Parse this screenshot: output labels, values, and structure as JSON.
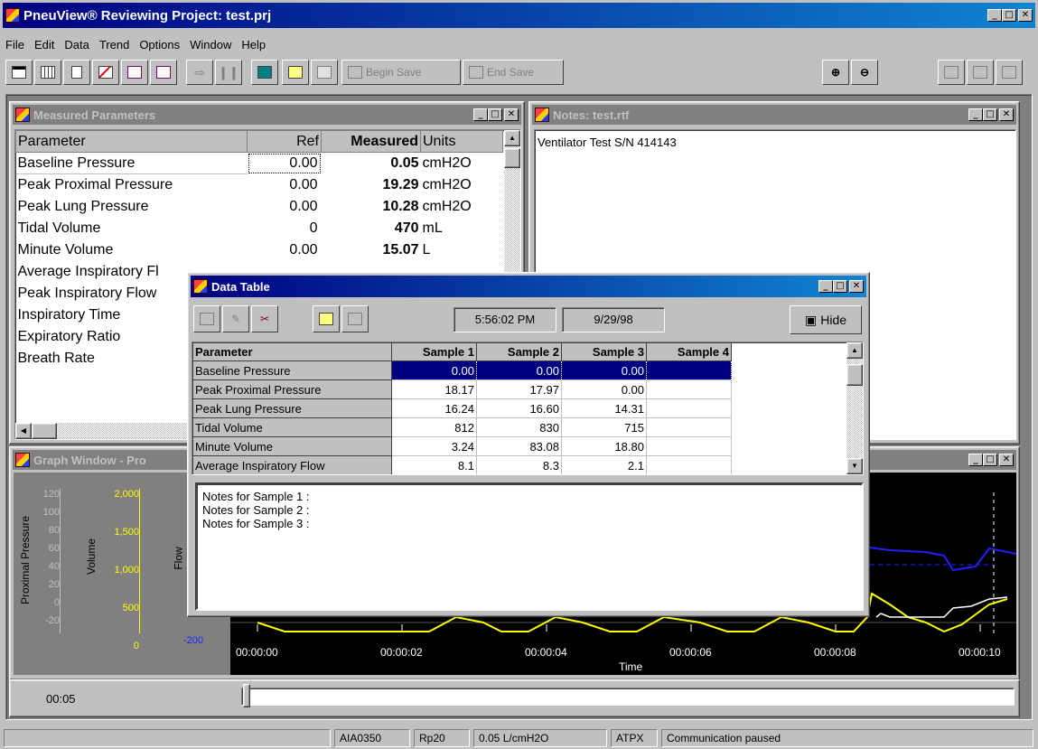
{
  "app": {
    "title": "PneuView® Reviewing Project: test.prj",
    "controls": {
      "minimize": "_",
      "restore": "□",
      "close": "✕"
    }
  },
  "menu": [
    "File",
    "Edit",
    "Data",
    "Trend",
    "Options",
    "Window",
    "Help"
  ],
  "toolbar": {
    "begin_save": "Begin Save",
    "end_save": "End Save",
    "icons": [
      "table-icon",
      "grid-icon",
      "document-icon",
      "chart-icon",
      "pv-icon",
      "fv-icon",
      "play-icon",
      "pause-icon",
      "monitor-icon",
      "open-folder-icon",
      "export-icon",
      "save-icon",
      "save-icon",
      "zoom-in-icon",
      "zoom-out-icon",
      "binoculars-icon",
      "export-icon",
      "import-icon"
    ]
  },
  "measured": {
    "title": "Measured Parameters",
    "headers": [
      "Parameter",
      "Ref",
      "Measured",
      "Units"
    ],
    "rows": [
      [
        "Baseline Pressure",
        "0.00",
        "0.05",
        "cmH2O"
      ],
      [
        "Peak Proximal Pressure",
        "0.00",
        "19.29",
        "cmH2O"
      ],
      [
        "Peak Lung Pressure",
        "0.00",
        "10.28",
        "cmH2O"
      ],
      [
        "Tidal Volume",
        "0",
        "470",
        "mL"
      ],
      [
        "Minute Volume",
        "0.00",
        "15.07",
        "L"
      ],
      [
        "Average Inspiratory Fl",
        "",
        "",
        ""
      ],
      [
        "Peak Inspiratory Flow",
        "",
        "",
        ""
      ],
      [
        "Inspiratory Time",
        "",
        "",
        ""
      ],
      [
        "Expiratory Ratio",
        "",
        "",
        ""
      ],
      [
        "Breath Rate",
        "",
        "",
        ""
      ]
    ]
  },
  "notes": {
    "title": "Notes: test.rtf",
    "content": "Ventilator Test S/N 414143"
  },
  "graph": {
    "title": "Graph Window - Pro",
    "y_axes": [
      {
        "label": "Proximal Pressure",
        "ticks": [
          "120",
          "100",
          "80",
          "60",
          "40",
          "20",
          "0",
          "-20"
        ],
        "color": "#ffffff"
      },
      {
        "label": "Volume",
        "ticks": [
          "2,000",
          "1,500",
          "1,000",
          "500",
          "0"
        ],
        "color": "#ffff00"
      },
      {
        "label": "Flow",
        "ticks": [
          "-200"
        ],
        "color": "#4040ff"
      }
    ],
    "x_label": "Time",
    "x_ticks": [
      "00:00:00",
      "00:00:02",
      "00:00:04",
      "00:00:06",
      "00:00:08",
      "00:00:10"
    ]
  },
  "timeline": {
    "position": "00:05"
  },
  "data_table": {
    "title": "Data Table",
    "time": "5:56:02 PM",
    "date": "9/29/98",
    "hide_label": "Hide",
    "headers": [
      "Parameter",
      "Sample 1",
      "Sample 2",
      "Sample 3",
      "Sample 4"
    ],
    "rows": [
      [
        "Baseline Pressure",
        "0.00",
        "0.00",
        "0.00",
        ""
      ],
      [
        "Peak Proximal Pressure",
        "18.17",
        "17.97",
        "0.00",
        ""
      ],
      [
        "Peak Lung Pressure",
        "16.24",
        "16.60",
        "14.31",
        ""
      ],
      [
        "Tidal Volume",
        "812",
        "830",
        "715",
        ""
      ],
      [
        "Minute Volume",
        "3.24",
        "83.08",
        "18.80",
        ""
      ],
      [
        "Average Inspiratory Flow",
        "8.1",
        "8.3",
        "2.1",
        ""
      ]
    ],
    "sample_notes": [
      "Notes for Sample 1 :",
      "Notes for Sample 2 :",
      "Notes for Sample 3 :"
    ]
  },
  "status_bar": [
    "AIA0350",
    "Rp20",
    "0.05 L/cmH2O",
    "ATPX",
    "Communication paused"
  ],
  "colors": {
    "title_active": "#000080",
    "selection": "#000080",
    "graph_bg": "#000000",
    "volume_trace": "#ffff00",
    "flow_trace": "#2020ff"
  }
}
